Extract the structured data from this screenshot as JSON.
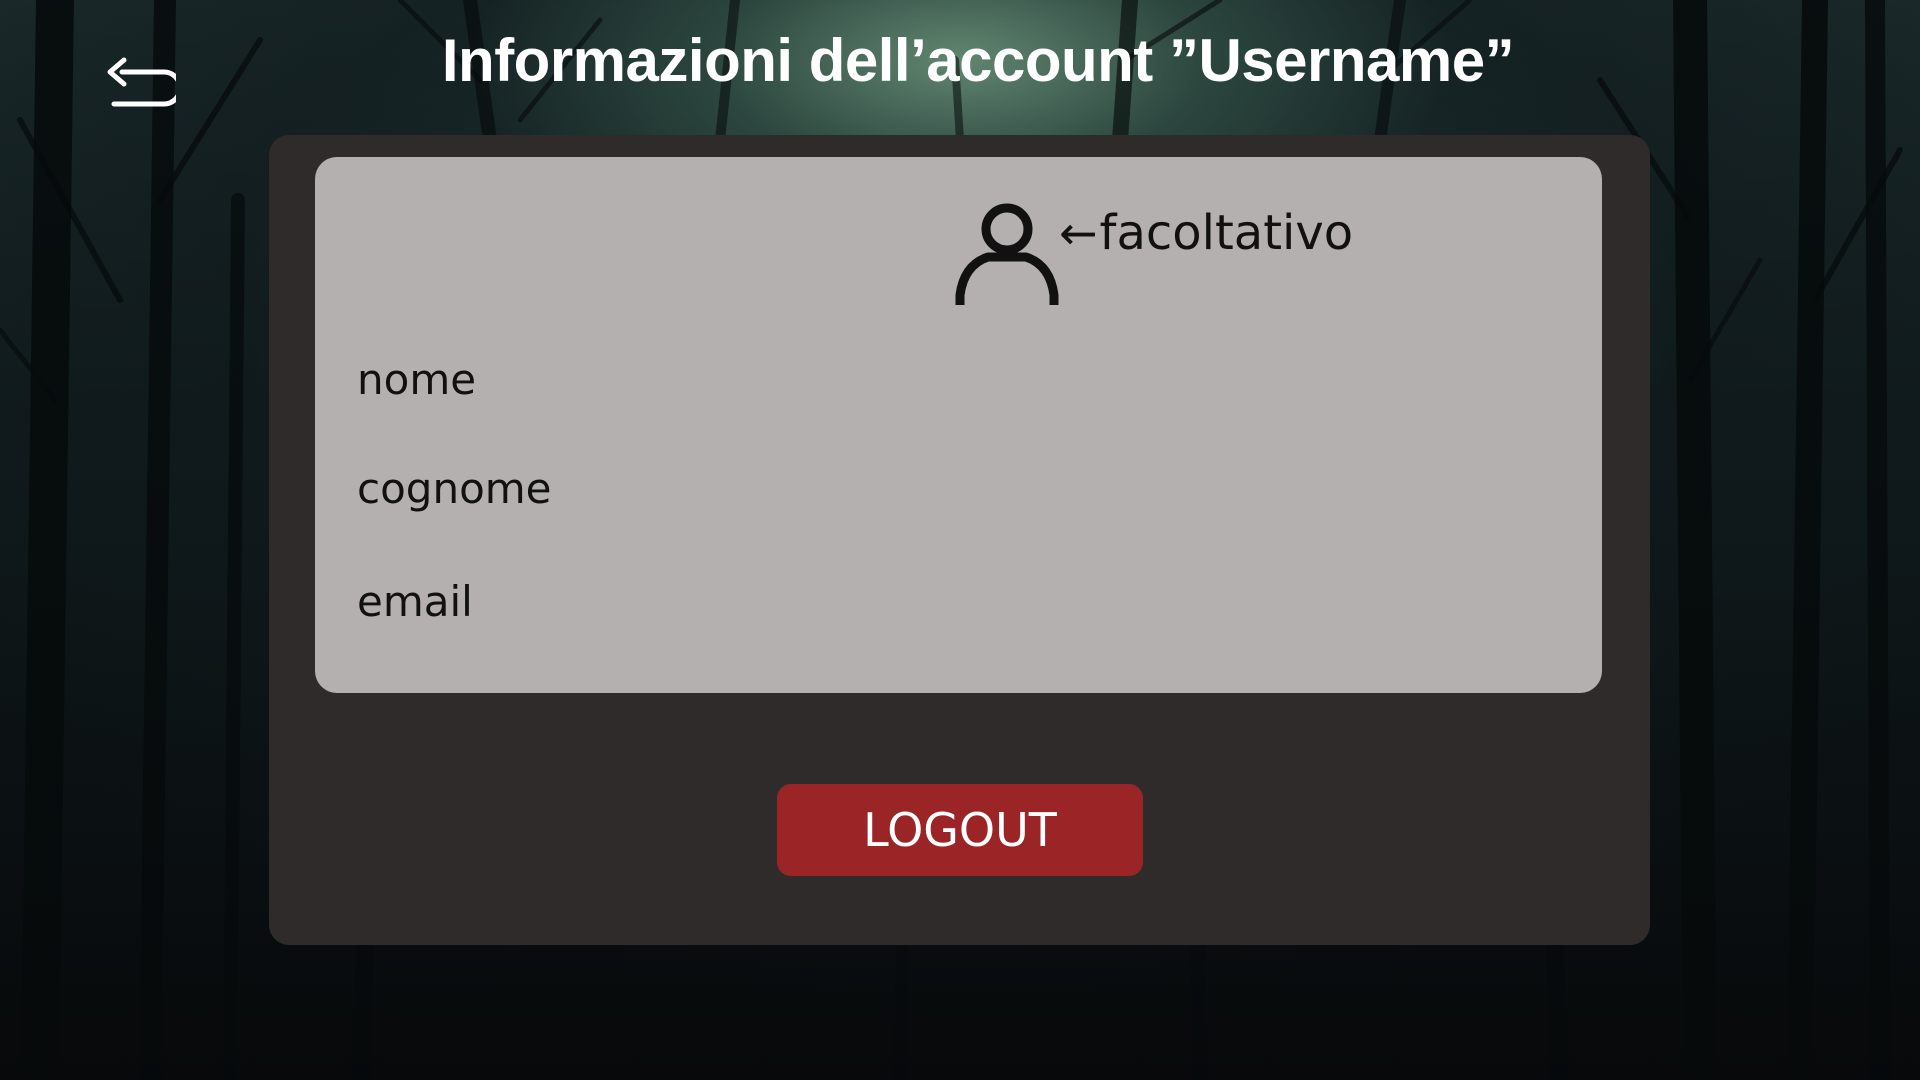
{
  "header": {
    "title": "Informazioni dell’account ”Username”",
    "back_icon": "undo-arrow-icon"
  },
  "profile": {
    "avatar_icon": "user-icon",
    "avatar_note_arrow": "←",
    "avatar_note": "facoltativo",
    "fields": {
      "nome": "nome",
      "cognome": "cognome",
      "email": "email"
    }
  },
  "actions": {
    "logout_label": "LOGOUT"
  },
  "colors": {
    "panel": "#302b2b",
    "card": "#b4b0af",
    "logout": "#9b2526",
    "title": "#ffffff"
  }
}
